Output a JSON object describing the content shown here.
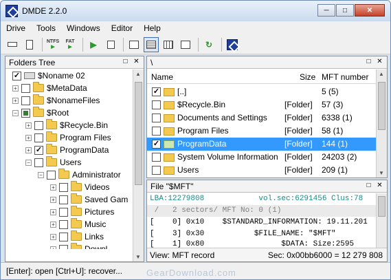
{
  "window": {
    "title": "DMDE 2.2.0",
    "controls": [
      "minimize",
      "maximize",
      "close"
    ]
  },
  "menu": [
    "Drive",
    "Tools",
    "Windows",
    "Editor",
    "Help"
  ],
  "toolbar": {
    "ntfs_label": "NTFS",
    "fat_label": "FAT"
  },
  "folders_tree": {
    "title": "Folders Tree",
    "nodes": [
      {
        "label": "$Noname 02",
        "checked": "partial",
        "icon": "drive-icon"
      },
      {
        "label": "$MetaData",
        "checked": "none",
        "icon": "folder-icon"
      },
      {
        "label": "$NonameFiles",
        "checked": "none",
        "icon": "folder-icon"
      },
      {
        "label": "$Root",
        "checked": "checked",
        "icon": "folder-icon"
      },
      {
        "label": "$Recycle.Bin",
        "checked": "none",
        "icon": "folder-icon"
      },
      {
        "label": "Program Files",
        "checked": "none",
        "icon": "folder-icon"
      },
      {
        "label": "ProgramData",
        "checked": "checked",
        "icon": "folder-icon"
      },
      {
        "label": "Users",
        "checked": "none",
        "icon": "folder-icon"
      },
      {
        "label": "Administrator",
        "checked": "none",
        "icon": "folder-icon"
      },
      {
        "label": "Videos",
        "checked": "none",
        "icon": "folder-icon"
      },
      {
        "label": "Saved Gam",
        "checked": "none",
        "icon": "folder-icon"
      },
      {
        "label": "Pictures",
        "checked": "none",
        "icon": "folder-icon"
      },
      {
        "label": "Music",
        "checked": "none",
        "icon": "folder-icon"
      },
      {
        "label": "Links",
        "checked": "none",
        "icon": "folder-icon"
      },
      {
        "label": "Downl",
        "checked": "none",
        "icon": "folder-icon"
      }
    ]
  },
  "file_list": {
    "path": "\\",
    "columns": {
      "name": "Name",
      "size": "Size",
      "mft": "MFT number"
    },
    "rows": [
      {
        "name": "[..]",
        "size": "",
        "mft": "5 (5)",
        "checked": true,
        "icon": "folder-up-icon"
      },
      {
        "name": "$Recycle.Bin",
        "size": "[Folder]",
        "mft": "57 (3)",
        "checked": false,
        "icon": "folder-icon"
      },
      {
        "name": "Documents and Settings",
        "size": "[Folder]",
        "mft": "6338 (1)",
        "checked": false,
        "icon": "folder-icon"
      },
      {
        "name": "Program Files",
        "size": "[Folder]",
        "mft": "58 (1)",
        "checked": false,
        "icon": "folder-icon"
      },
      {
        "name": "ProgramData",
        "size": "[Folder]",
        "mft": "144 (1)",
        "checked": true,
        "icon": "folder-icon",
        "selected": true
      },
      {
        "name": "System Volume Information",
        "size": "[Folder]",
        "mft": "24203 (2)",
        "checked": false,
        "icon": "folder-icon"
      },
      {
        "name": "Users",
        "size": "[Folder]",
        "mft": "209 (1)",
        "checked": false,
        "icon": "folder-icon"
      }
    ]
  },
  "record_view": {
    "title": "File \"$MFT\"",
    "lba_line": "LBA:12279808            vol.sec:6291456 Clus:78",
    "info_line": " /   2 sectors/ MFT No: 0 (1)",
    "lines": [
      "[    0] 0x10    $STANDARD_INFORMATION: 19.11.201",
      "[    3] 0x30           $FILE_NAME: \"$MFT\"",
      "[    1] 0x80                 $DATA: Size:2595"
    ],
    "view_label": "View: MFT record",
    "sec_label": "Sec: 0x00bb6000 = 12 279 808"
  },
  "status": {
    "text": "[Enter]: open  [Ctrl+U]: recover..."
  },
  "watermark": "GearDownload.com",
  "colors": {
    "selection": "#3399ff",
    "lba_text": "#1a8a8a",
    "folder": "#f4c94f"
  }
}
